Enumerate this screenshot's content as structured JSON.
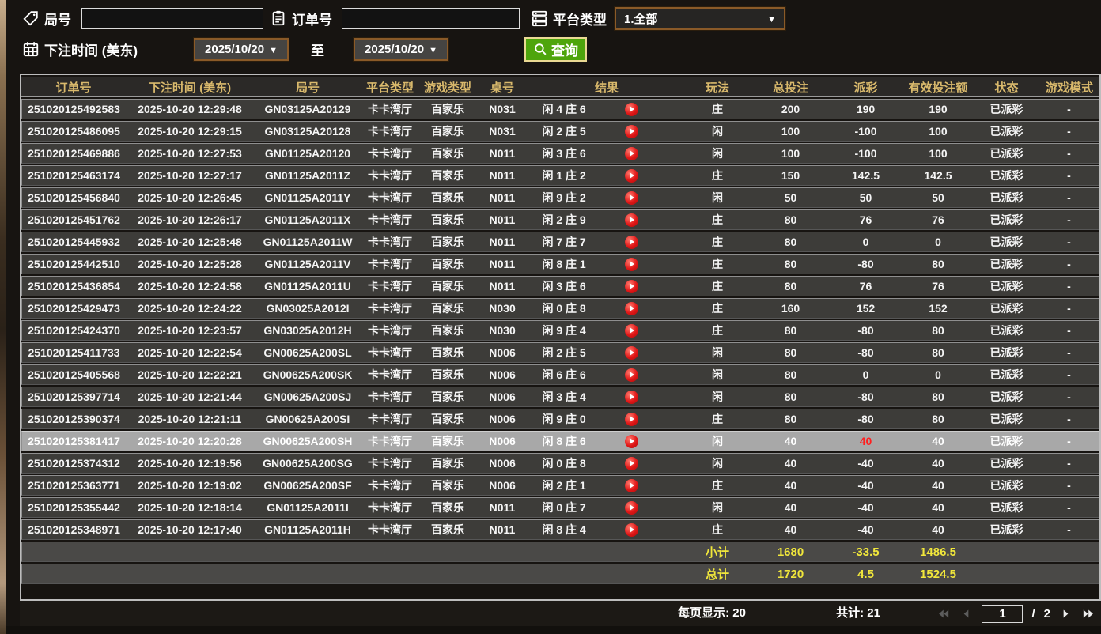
{
  "palette": {
    "header_gold": "#d9b96c",
    "win_red": "#e0352b",
    "loss_green": "#62dd12",
    "status_green": "#2fd32f",
    "totals_yellow": "#f1e73b",
    "button_green": "#4ea50c",
    "picker_border_brown": "#8a5a28",
    "highlight_row_gray": "#a8a8a8"
  },
  "filters": {
    "round_label": "局号",
    "round_value": "",
    "order_label": "订单号",
    "order_value": "",
    "platform_label": "平台类型",
    "platform_value": "1.全部",
    "bet_time_label": "下注时间 (美东)",
    "range_to_label": "至",
    "date_from": "2025/10/20",
    "date_to": "2025/10/20",
    "search_label": "查询"
  },
  "table": {
    "columns": [
      "订单号",
      "下注时间 (美东)",
      "局号",
      "平台类型",
      "游戏类型",
      "桌号",
      "结果",
      "玩法",
      "总投注",
      "派彩",
      "有效投注额",
      "状态",
      "游戏模式"
    ],
    "rows": [
      {
        "order_no": "251020125492583",
        "bet_time": "2025-10-20 12:29:48",
        "round_no": "GN03125A20129",
        "platform": "卡卡湾厅",
        "game_type": "百家乐",
        "table_no": "N031",
        "result": "闲 4 庄 6",
        "play": "庄",
        "total_bet": "200",
        "payout": "190",
        "payout_color": "win",
        "valid_bet": "190",
        "status": "已派彩",
        "mode": "-",
        "highlight": false
      },
      {
        "order_no": "251020125486095",
        "bet_time": "2025-10-20 12:29:15",
        "round_no": "GN03125A20128",
        "platform": "卡卡湾厅",
        "game_type": "百家乐",
        "table_no": "N031",
        "result": "闲 2 庄 5",
        "play": "闲",
        "total_bet": "100",
        "payout": "-100",
        "payout_color": "loss",
        "valid_bet": "100",
        "status": "已派彩",
        "mode": "-",
        "highlight": false
      },
      {
        "order_no": "251020125469886",
        "bet_time": "2025-10-20 12:27:53",
        "round_no": "GN01125A20120",
        "platform": "卡卡湾厅",
        "game_type": "百家乐",
        "table_no": "N011",
        "result": "闲 3 庄 6",
        "play": "闲",
        "total_bet": "100",
        "payout": "-100",
        "payout_color": "loss",
        "valid_bet": "100",
        "status": "已派彩",
        "mode": "-",
        "highlight": false
      },
      {
        "order_no": "251020125463174",
        "bet_time": "2025-10-20 12:27:17",
        "round_no": "GN01125A2011Z",
        "platform": "卡卡湾厅",
        "game_type": "百家乐",
        "table_no": "N011",
        "result": "闲 1 庄 2",
        "play": "庄",
        "total_bet": "150",
        "payout": "142.5",
        "payout_color": "win",
        "valid_bet": "142.5",
        "status": "已派彩",
        "mode": "-",
        "highlight": false
      },
      {
        "order_no": "251020125456840",
        "bet_time": "2025-10-20 12:26:45",
        "round_no": "GN01125A2011Y",
        "platform": "卡卡湾厅",
        "game_type": "百家乐",
        "table_no": "N011",
        "result": "闲 9 庄 2",
        "play": "闲",
        "total_bet": "50",
        "payout": "50",
        "payout_color": "win",
        "valid_bet": "50",
        "status": "已派彩",
        "mode": "-",
        "highlight": false
      },
      {
        "order_no": "251020125451762",
        "bet_time": "2025-10-20 12:26:17",
        "round_no": "GN01125A2011X",
        "platform": "卡卡湾厅",
        "game_type": "百家乐",
        "table_no": "N011",
        "result": "闲 2 庄 9",
        "play": "庄",
        "total_bet": "80",
        "payout": "76",
        "payout_color": "win",
        "valid_bet": "76",
        "status": "已派彩",
        "mode": "-",
        "highlight": false
      },
      {
        "order_no": "251020125445932",
        "bet_time": "2025-10-20 12:25:48",
        "round_no": "GN01125A2011W",
        "platform": "卡卡湾厅",
        "game_type": "百家乐",
        "table_no": "N011",
        "result": "闲 7 庄 7",
        "play": "庄",
        "total_bet": "80",
        "payout": "0",
        "payout_color": "zero",
        "valid_bet": "0",
        "status": "已派彩",
        "mode": "-",
        "highlight": false
      },
      {
        "order_no": "251020125442510",
        "bet_time": "2025-10-20 12:25:28",
        "round_no": "GN01125A2011V",
        "platform": "卡卡湾厅",
        "game_type": "百家乐",
        "table_no": "N011",
        "result": "闲 8 庄 1",
        "play": "庄",
        "total_bet": "80",
        "payout": "-80",
        "payout_color": "loss",
        "valid_bet": "80",
        "status": "已派彩",
        "mode": "-",
        "highlight": false
      },
      {
        "order_no": "251020125436854",
        "bet_time": "2025-10-20 12:24:58",
        "round_no": "GN01125A2011U",
        "platform": "卡卡湾厅",
        "game_type": "百家乐",
        "table_no": "N011",
        "result": "闲 3 庄 6",
        "play": "庄",
        "total_bet": "80",
        "payout": "76",
        "payout_color": "win",
        "valid_bet": "76",
        "status": "已派彩",
        "mode": "-",
        "highlight": false
      },
      {
        "order_no": "251020125429473",
        "bet_time": "2025-10-20 12:24:22",
        "round_no": "GN03025A2012I",
        "platform": "卡卡湾厅",
        "game_type": "百家乐",
        "table_no": "N030",
        "result": "闲 0 庄 8",
        "play": "庄",
        "total_bet": "160",
        "payout": "152",
        "payout_color": "win",
        "valid_bet": "152",
        "status": "已派彩",
        "mode": "-",
        "highlight": false
      },
      {
        "order_no": "251020125424370",
        "bet_time": "2025-10-20 12:23:57",
        "round_no": "GN03025A2012H",
        "platform": "卡卡湾厅",
        "game_type": "百家乐",
        "table_no": "N030",
        "result": "闲 9 庄 4",
        "play": "庄",
        "total_bet": "80",
        "payout": "-80",
        "payout_color": "loss",
        "valid_bet": "80",
        "status": "已派彩",
        "mode": "-",
        "highlight": false
      },
      {
        "order_no": "251020125411733",
        "bet_time": "2025-10-20 12:22:54",
        "round_no": "GN00625A200SL",
        "platform": "卡卡湾厅",
        "game_type": "百家乐",
        "table_no": "N006",
        "result": "闲 2 庄 5",
        "play": "闲",
        "total_bet": "80",
        "payout": "-80",
        "payout_color": "loss",
        "valid_bet": "80",
        "status": "已派彩",
        "mode": "-",
        "highlight": false
      },
      {
        "order_no": "251020125405568",
        "bet_time": "2025-10-20 12:22:21",
        "round_no": "GN00625A200SK",
        "platform": "卡卡湾厅",
        "game_type": "百家乐",
        "table_no": "N006",
        "result": "闲 6 庄 6",
        "play": "闲",
        "total_bet": "80",
        "payout": "0",
        "payout_color": "zero",
        "valid_bet": "0",
        "status": "已派彩",
        "mode": "-",
        "highlight": false
      },
      {
        "order_no": "251020125397714",
        "bet_time": "2025-10-20 12:21:44",
        "round_no": "GN00625A200SJ",
        "platform": "卡卡湾厅",
        "game_type": "百家乐",
        "table_no": "N006",
        "result": "闲 3 庄 4",
        "play": "闲",
        "total_bet": "80",
        "payout": "-80",
        "payout_color": "loss",
        "valid_bet": "80",
        "status": "已派彩",
        "mode": "-",
        "highlight": false
      },
      {
        "order_no": "251020125390374",
        "bet_time": "2025-10-20 12:21:11",
        "round_no": "GN00625A200SI",
        "platform": "卡卡湾厅",
        "game_type": "百家乐",
        "table_no": "N006",
        "result": "闲 9 庄 0",
        "play": "庄",
        "total_bet": "80",
        "payout": "-80",
        "payout_color": "loss",
        "valid_bet": "80",
        "status": "已派彩",
        "mode": "-",
        "highlight": false
      },
      {
        "order_no": "251020125381417",
        "bet_time": "2025-10-20 12:20:28",
        "round_no": "GN00625A200SH",
        "platform": "卡卡湾厅",
        "game_type": "百家乐",
        "table_no": "N006",
        "result": "闲 8 庄 6",
        "play": "闲",
        "total_bet": "40",
        "payout": "40",
        "payout_color": "win",
        "valid_bet": "40",
        "status": "已派彩",
        "mode": "-",
        "highlight": true
      },
      {
        "order_no": "251020125374312",
        "bet_time": "2025-10-20 12:19:56",
        "round_no": "GN00625A200SG",
        "platform": "卡卡湾厅",
        "game_type": "百家乐",
        "table_no": "N006",
        "result": "闲 0 庄 8",
        "play": "闲",
        "total_bet": "40",
        "payout": "-40",
        "payout_color": "loss",
        "valid_bet": "40",
        "status": "已派彩",
        "mode": "-",
        "highlight": false
      },
      {
        "order_no": "251020125363771",
        "bet_time": "2025-10-20 12:19:02",
        "round_no": "GN00625A200SF",
        "platform": "卡卡湾厅",
        "game_type": "百家乐",
        "table_no": "N006",
        "result": "闲 2 庄 1",
        "play": "庄",
        "total_bet": "40",
        "payout": "-40",
        "payout_color": "loss",
        "valid_bet": "40",
        "status": "已派彩",
        "mode": "-",
        "highlight": false
      },
      {
        "order_no": "251020125355442",
        "bet_time": "2025-10-20 12:18:14",
        "round_no": "GN01125A2011I",
        "platform": "卡卡湾厅",
        "game_type": "百家乐",
        "table_no": "N011",
        "result": "闲 0 庄 7",
        "play": "闲",
        "total_bet": "40",
        "payout": "-40",
        "payout_color": "loss",
        "valid_bet": "40",
        "status": "已派彩",
        "mode": "-",
        "highlight": false
      },
      {
        "order_no": "251020125348971",
        "bet_time": "2025-10-20 12:17:40",
        "round_no": "GN01125A2011H",
        "platform": "卡卡湾厅",
        "game_type": "百家乐",
        "table_no": "N011",
        "result": "闲 8 庄 4",
        "play": "庄",
        "total_bet": "40",
        "payout": "-40",
        "payout_color": "loss",
        "valid_bet": "40",
        "status": "已派彩",
        "mode": "-",
        "highlight": false
      }
    ],
    "subtotal": {
      "label": "小计",
      "total_bet": "1680",
      "payout": "-33.5",
      "valid_bet": "1486.5"
    },
    "grand_total": {
      "label": "总计",
      "total_bet": "1720",
      "payout": "4.5",
      "valid_bet": "1524.5"
    }
  },
  "pagination": {
    "per_page": "每页显示: 20",
    "total_count": "共计: 21",
    "current_page": "1",
    "separator": "/",
    "total_pages": "2"
  }
}
